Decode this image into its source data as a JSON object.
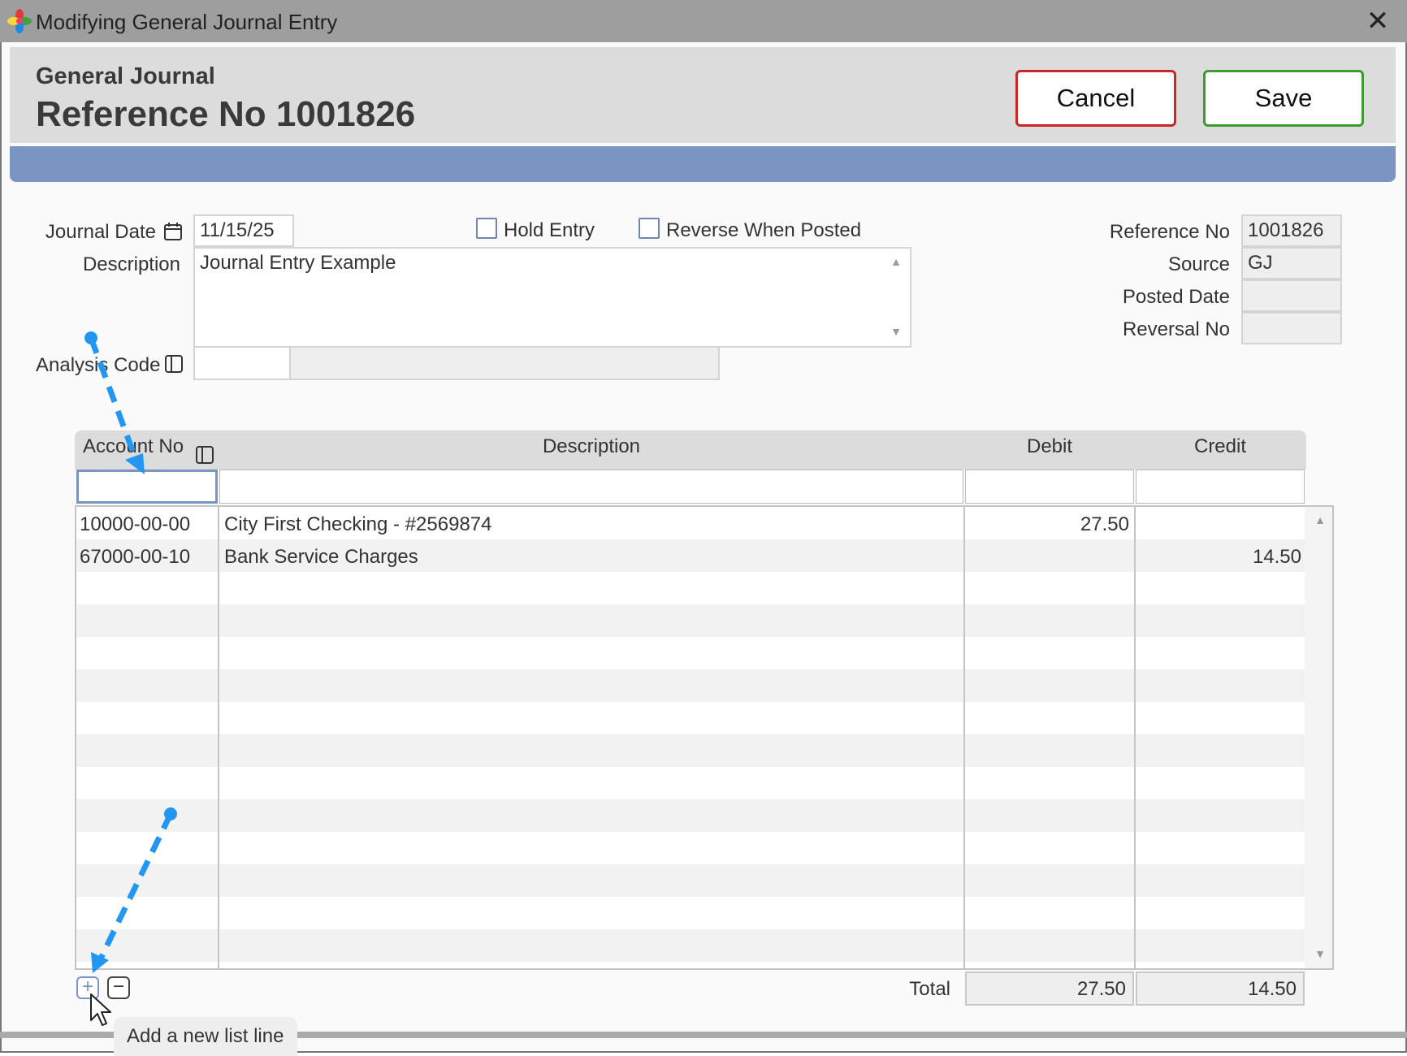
{
  "window": {
    "title": "Modifying General Journal Entry",
    "close_glyph": "✕"
  },
  "header": {
    "subtitle": "General Journal",
    "title": "Reference No 1001826",
    "cancel_label": "Cancel",
    "save_label": "Save"
  },
  "form": {
    "journal_date_label": "Journal Date",
    "journal_date_value": "11/15/25",
    "hold_entry_label": "Hold Entry",
    "hold_entry_checked": false,
    "reverse_label": "Reverse When Posted",
    "reverse_checked": false,
    "description_label": "Description",
    "description_value": "Journal Entry Example",
    "analysis_code_label": "Analysis Code",
    "analysis_code_value": "",
    "analysis_code_desc": "",
    "reference_no_label": "Reference No",
    "reference_no_value": "1001826",
    "source_label": "Source",
    "source_value": "GJ",
    "posted_date_label": "Posted Date",
    "posted_date_value": "",
    "reversal_no_label": "Reversal No",
    "reversal_no_value": ""
  },
  "grid": {
    "columns": [
      "Account No",
      "Description",
      "Debit",
      "Credit"
    ],
    "rows": [
      {
        "account": "10000-00-00",
        "description": "City First Checking - #2569874",
        "debit": "27.50",
        "credit": ""
      },
      {
        "account": "67000-00-10",
        "description": "Bank Service Charges",
        "debit": "",
        "credit": "14.50"
      }
    ],
    "total_label": "Total",
    "total_debit": "27.50",
    "total_credit": "14.50"
  },
  "toolbar": {
    "add_glyph": "+",
    "remove_glyph": "−"
  },
  "tooltip": {
    "text": "Add a new list line"
  },
  "colors": {
    "accent": "#7b95c2",
    "cancel_border": "#c62828",
    "save_border": "#3c9a2e",
    "annotation_arrow": "#2196f3"
  },
  "icons": [
    "app-icon",
    "close-icon",
    "calendar-icon",
    "lookup-icon",
    "add-line-icon",
    "remove-line-icon",
    "mouse-cursor-icon",
    "annotation-arrow"
  ]
}
